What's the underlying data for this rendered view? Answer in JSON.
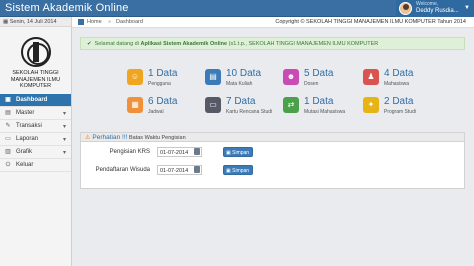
{
  "app": {
    "title": "Sistem Akademik Online",
    "user": {
      "welcome": "Welcome,",
      "name": "Deddy Rusdia..."
    }
  },
  "sidebar": {
    "date": "Senin, 14 Juli 2014",
    "school_name": "SEKOLAH TINGGI MANAJEMEN ILMU KOMPUTER",
    "items": [
      {
        "label": "Dashboard",
        "icon": "dashboard-icon",
        "active": true
      },
      {
        "label": "Master",
        "icon": "folder-icon"
      },
      {
        "label": "Transaksi",
        "icon": "edit-icon"
      },
      {
        "label": "Laporan",
        "icon": "report-icon"
      },
      {
        "label": "Grafik",
        "icon": "chart-icon"
      },
      {
        "label": "Keluar",
        "icon": "logout-icon"
      }
    ]
  },
  "breadcrumb": {
    "home": "Home",
    "separator": "»",
    "current": "Dashboard"
  },
  "copyright": "Copyright © SEKOLAH TINGGI MANAJEMEN ILMU KOMPUTER Tahun 2014",
  "alert": {
    "text_prefix": "Selamat datang di",
    "text_bold": "Aplikasi Sistem Akademik Online",
    "text_suffix": "(s1.t.p., SEKOLAH TINGGI MANAJEMEN ILMU KOMPUTER"
  },
  "stats": [
    {
      "value": "1 Data",
      "label": "Pengguna",
      "color": "#f0a520",
      "icon": "user-icon"
    },
    {
      "value": "10 Data",
      "label": "Mata Kuliah",
      "color": "#3a7bb8",
      "icon": "book-icon"
    },
    {
      "value": "5 Data",
      "label": "Dosen",
      "color": "#c94bb5",
      "icon": "teacher-icon"
    },
    {
      "value": "4 Data",
      "label": "Mahasiswa",
      "color": "#d9534f",
      "icon": "student-icon"
    },
    {
      "value": "6 Data",
      "label": "Jadwal",
      "color": "#f0913a",
      "icon": "calendar-icon"
    },
    {
      "value": "7 Data",
      "label": "Kartu Rencana Studi",
      "color": "#555a66",
      "icon": "card-icon"
    },
    {
      "value": "1 Data",
      "label": "Mutasi Mahasiswa",
      "color": "#4aa14a",
      "icon": "transfer-icon"
    },
    {
      "value": "2 Data",
      "label": "Program Studi",
      "color": "#e7b416",
      "icon": "program-icon"
    }
  ],
  "panel": {
    "title": "Perhatian !!!",
    "subtitle": "Batas Waktu Pengisian",
    "rows": [
      {
        "label": "Pengisian KRS",
        "value": "01-07-2014",
        "button": "Simpan"
      },
      {
        "label": "Pendaftaran Wisuda",
        "value": "01-07-2014",
        "button": "Simpan"
      }
    ]
  }
}
